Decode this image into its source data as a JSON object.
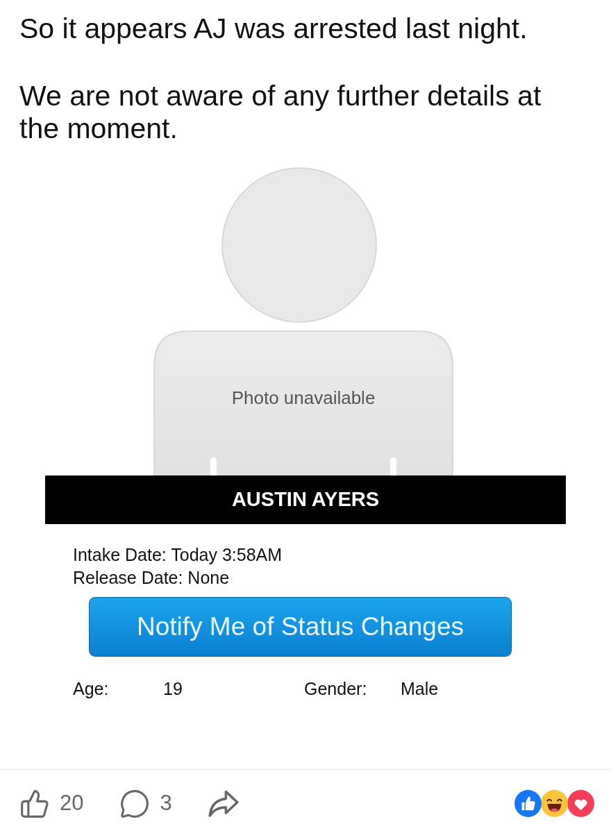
{
  "post": {
    "paragraphs": [
      "So it appears AJ was arrested last night.",
      "We are not aware of any further details at the moment."
    ]
  },
  "record": {
    "photo_caption": "Photo unavailable",
    "name": "AUSTIN AYERS",
    "date_lines": [
      "Intake Date: Today 3:58AM",
      "Release Date: None"
    ],
    "notify_button": "Notify Me of Status Changes",
    "fields": [
      {
        "label": "Age:",
        "value": "19"
      },
      {
        "label": "Gender:",
        "value": "Male"
      }
    ]
  },
  "actions": [
    {
      "kind": "like",
      "count": "20"
    },
    {
      "kind": "comment",
      "count": "3"
    },
    {
      "kind": "share"
    }
  ],
  "reactions": [
    {
      "kind": "like"
    },
    {
      "kind": "haha"
    },
    {
      "kind": "love"
    }
  ]
}
